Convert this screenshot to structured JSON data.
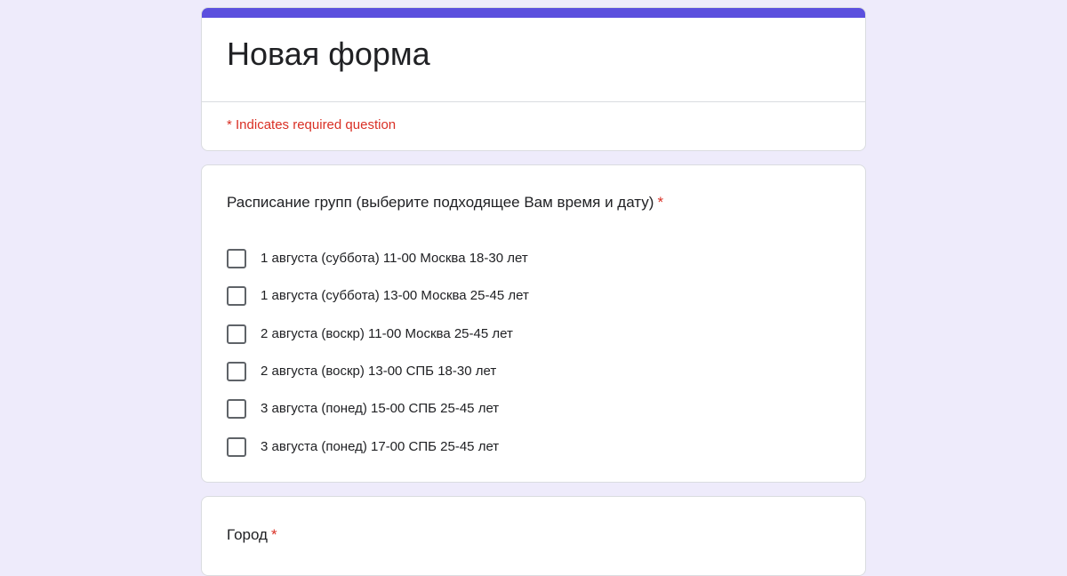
{
  "form": {
    "title": "Новая форма",
    "required_note": "* Indicates required question",
    "accent_color": "#5b4fde"
  },
  "questions": [
    {
      "title": "Расписание групп (выберите подходящее Вам время и дату)",
      "required_star": "*",
      "type": "checkbox",
      "options": [
        {
          "label": "1 августа (суббота) 11-00 Москва 18-30 лет",
          "checked": false
        },
        {
          "label": "1 августа (суббота) 13-00 Москва 25-45 лет",
          "checked": false
        },
        {
          "label": "2 августа (воскр) 11-00 Москва 25-45 лет",
          "checked": false
        },
        {
          "label": "2 августа (воскр) 13-00 СПБ 18-30 лет",
          "checked": false
        },
        {
          "label": "3 августа (понед) 15-00 СПБ 25-45 лет",
          "checked": false
        },
        {
          "label": "3 августа (понед) 17-00 СПБ 25-45 лет",
          "checked": false
        }
      ]
    },
    {
      "title": "Город",
      "required_star": "*"
    }
  ]
}
